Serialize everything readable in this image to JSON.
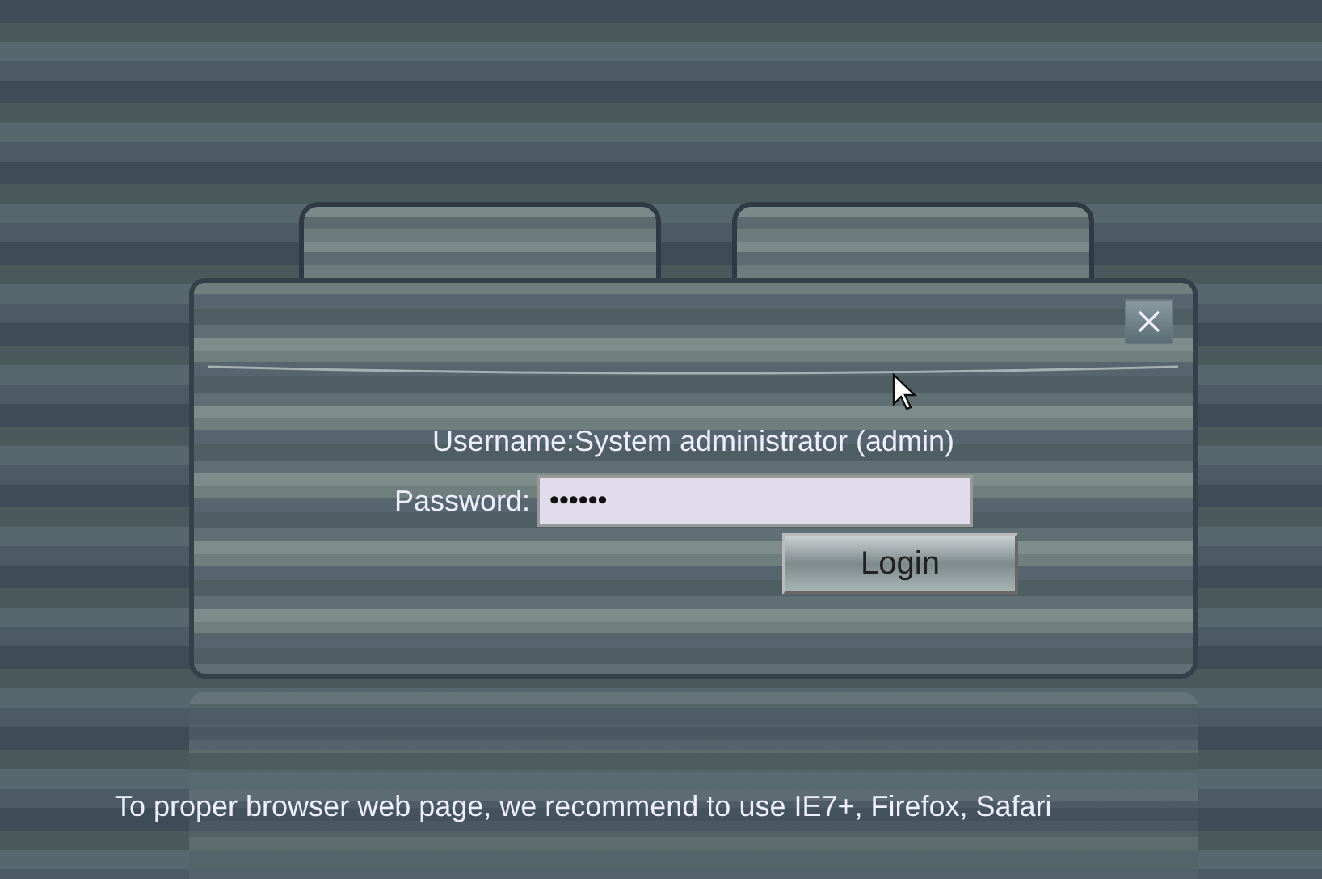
{
  "dialog": {
    "username": "Username:System administrator (admin)",
    "password": {
      "label": "Password:",
      "value": "••••••"
    },
    "login_button": "Login"
  },
  "footer_notice": "To proper browser web page, we recommend to use IE7+, Firefox, Safari"
}
